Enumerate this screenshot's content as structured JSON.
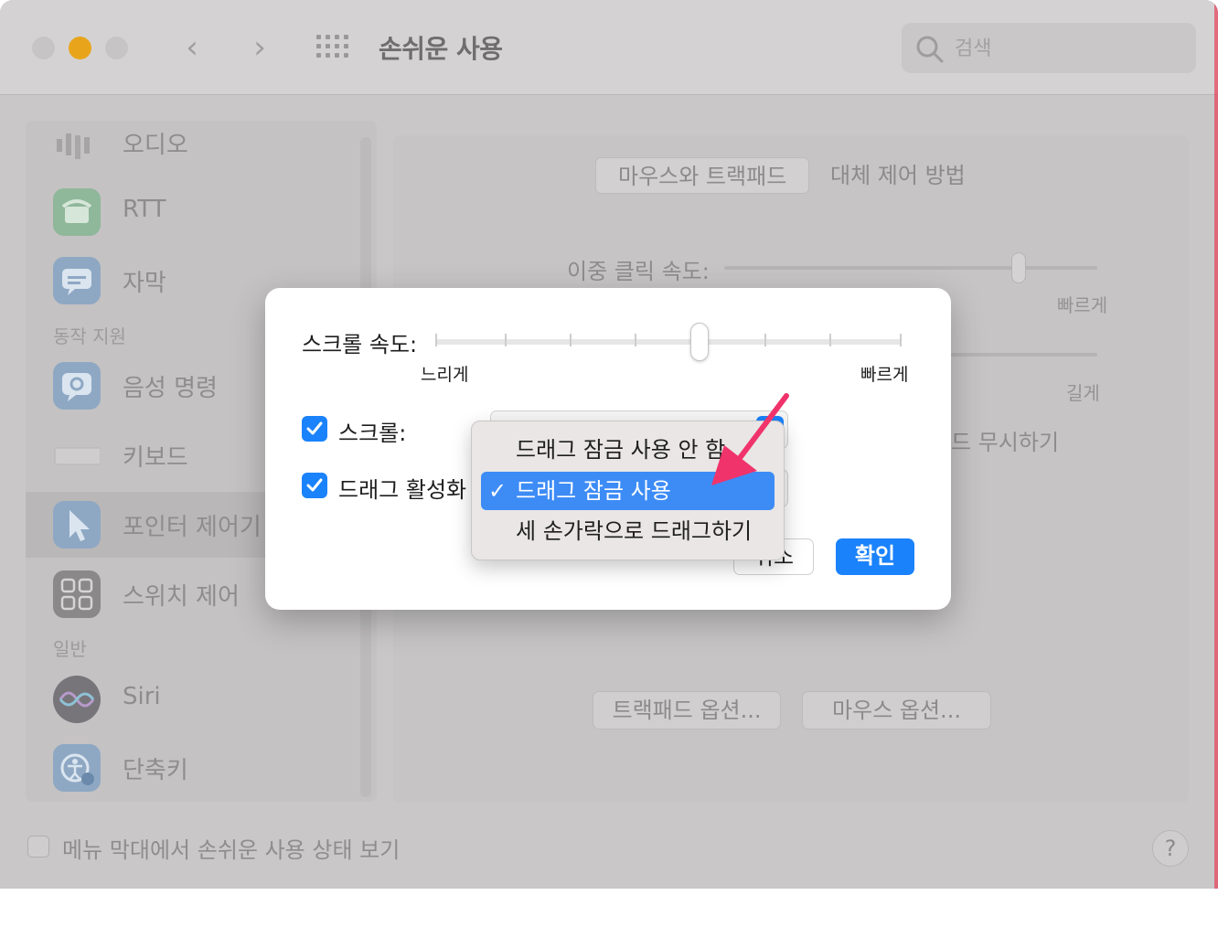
{
  "window": {
    "title": "손쉬운 사용",
    "search_placeholder": "검색"
  },
  "sidebar": {
    "items": [
      {
        "label": "오디오",
        "icon": "audio-icon"
      },
      {
        "label": "RTT",
        "icon": "rtt-icon"
      },
      {
        "label": "자막",
        "icon": "captions-icon"
      },
      {
        "label": "음성 명령",
        "icon": "voice-control-icon"
      },
      {
        "label": "키보드",
        "icon": "keyboard-icon"
      },
      {
        "label": "포인터 제어기",
        "icon": "pointer-icon"
      },
      {
        "label": "스위치 제어",
        "icon": "switch-control-icon"
      },
      {
        "label": "Siri",
        "icon": "siri-icon"
      },
      {
        "label": "단축키",
        "icon": "shortcut-icon"
      }
    ],
    "sections": [
      "동작 지원",
      "일반"
    ],
    "selected": "포인터 제어기"
  },
  "content": {
    "tabs": [
      "마우스와 트랙패드",
      "대체 제어 방법"
    ],
    "double_click_label": "이중 클릭 속도:",
    "fast_label": "빠르게",
    "long_label": "길게",
    "ignore_partial": "드 무시하기",
    "trackpad_options": "트랙패드 옵션...",
    "mouse_options": "마우스 옵션..."
  },
  "footer": {
    "show_status_label": "메뉴 막대에서 손쉬운 사용 상태 보기",
    "help": "?"
  },
  "dialog": {
    "scroll_speed_label": "스크롤 속도:",
    "slow_label": "느리게",
    "fast_label": "빠르게",
    "scroll_speed_value": 0.57,
    "scroll_label": "스크롤:",
    "scroll_checked": true,
    "drag_label": "드래그 활성화",
    "drag_checked": true,
    "cancel_visible": "취소",
    "ok": "확인"
  },
  "dropdown": {
    "options": [
      "드래그 잠금 사용 안 함",
      "드래그 잠금 사용",
      "세 손가락으로 드래그하기"
    ],
    "selected_index": 1,
    "check_mark": "✓"
  },
  "colors": {
    "accent": "#1a82fb",
    "menu_highlight": "#3d8cf6",
    "annotation_arrow": "#f0336b"
  }
}
